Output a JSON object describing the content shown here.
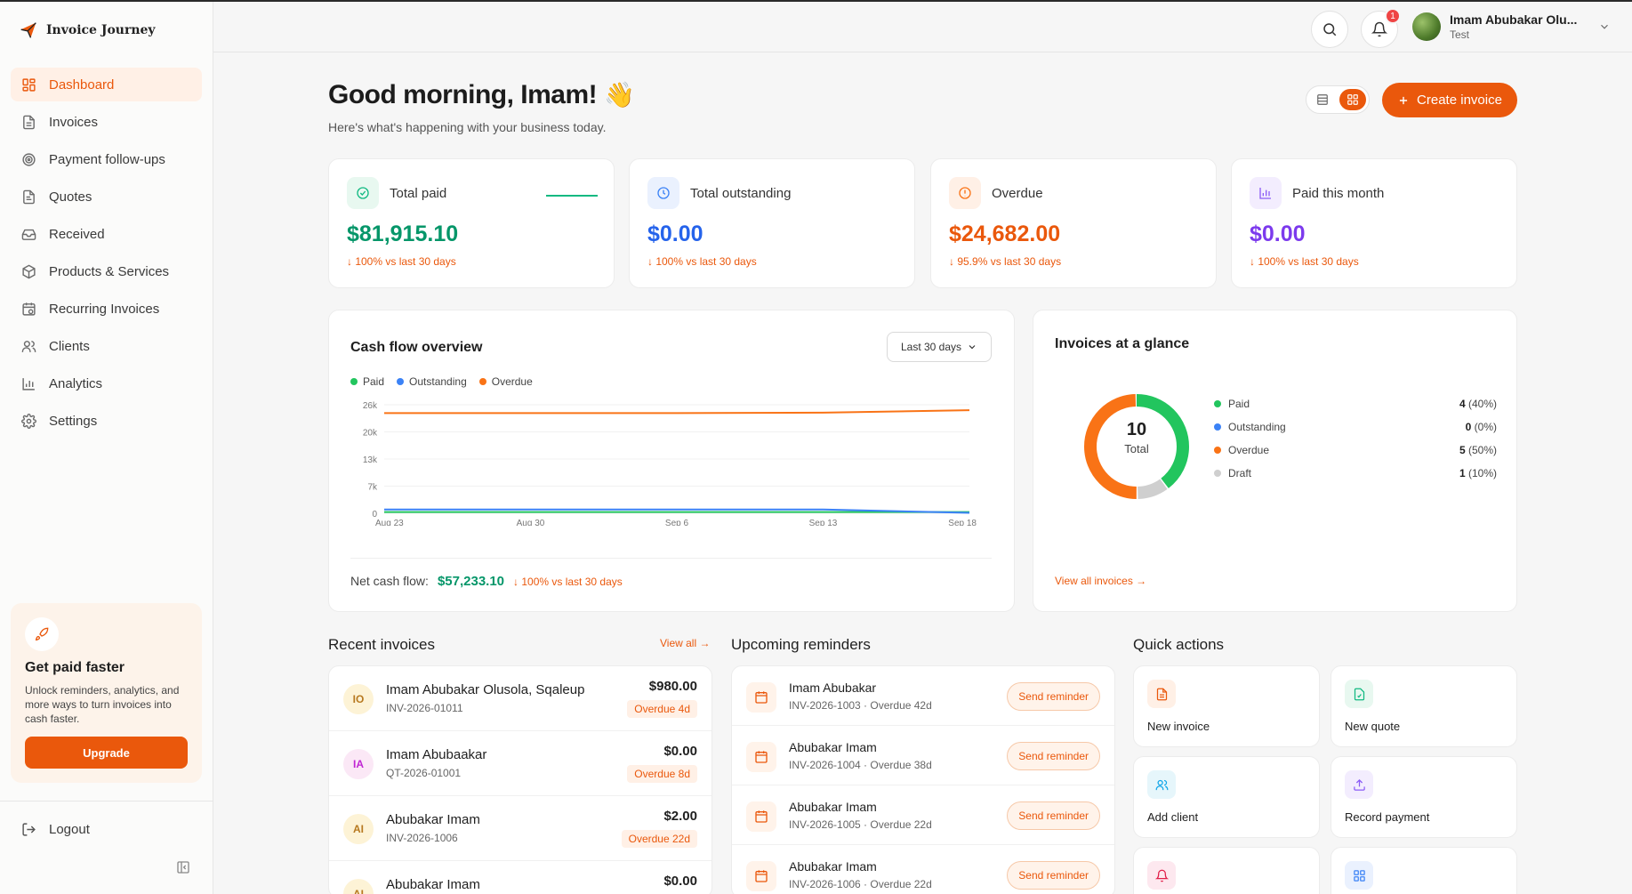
{
  "app": {
    "name": "Invoice Journey"
  },
  "sidebar": {
    "items": [
      {
        "label": "Dashboard",
        "icon": "dashboard-icon",
        "active": true
      },
      {
        "label": "Invoices",
        "icon": "file-icon"
      },
      {
        "label": "Payment follow-ups",
        "icon": "target-icon"
      },
      {
        "label": "Quotes",
        "icon": "quote-icon"
      },
      {
        "label": "Received",
        "icon": "inbox-icon"
      },
      {
        "label": "Products & Services",
        "icon": "package-icon"
      },
      {
        "label": "Recurring Invoices",
        "icon": "calendar-repeat-icon"
      },
      {
        "label": "Clients",
        "icon": "users-icon"
      },
      {
        "label": "Analytics",
        "icon": "bar-chart-icon"
      },
      {
        "label": "Settings",
        "icon": "gear-icon"
      }
    ],
    "promo": {
      "title": "Get paid faster",
      "text": "Unlock reminders, analytics, and more ways to turn invoices into cash faster.",
      "button": "Upgrade"
    },
    "logout": "Logout"
  },
  "topbar": {
    "notifications_count": "1",
    "user_name": "Imam Abubakar Olu...",
    "user_sub": "Test"
  },
  "header": {
    "greeting": "Good morning, Imam!",
    "greeting_emoji": "👋",
    "subtitle": "Here's what's happening with your business today.",
    "create_button": "Create invoice"
  },
  "stats": [
    {
      "label": "Total paid",
      "value": "$81,915.10",
      "delta": "↓ 100% vs last 30 days",
      "color": "#059669",
      "icon_bg": "#e8f8f0",
      "icon_color": "#10b981"
    },
    {
      "label": "Total outstanding",
      "value": "$0.00",
      "delta": "↓ 100% vs last 30 days",
      "color": "#2563eb",
      "icon_bg": "#eaf1fe",
      "icon_color": "#3b82f6"
    },
    {
      "label": "Overdue",
      "value": "$24,682.00",
      "delta": "↓ 95.9% vs last 30 days",
      "color": "#ea580c",
      "icon_bg": "#fff0e6",
      "icon_color": "#f97316"
    },
    {
      "label": "Paid this month",
      "value": "$0.00",
      "delta": "↓ 100% vs last 30 days",
      "color": "#7c3aed",
      "icon_bg": "#f3edfe",
      "icon_color": "#8b5cf6"
    }
  ],
  "cashflow": {
    "title": "Cash flow overview",
    "range": "Last 30 days",
    "legend": [
      "Paid",
      "Outstanding",
      "Overdue"
    ],
    "net_label": "Net cash flow:",
    "net_value": "$57,233.10",
    "net_delta": "↓ 100% vs last 30 days"
  },
  "chart_data": {
    "type": "line",
    "title": "Cash flow overview",
    "x": [
      "Aug 23",
      "Aug 30",
      "Sep 6",
      "Sep 13",
      "Sep 18"
    ],
    "y_ticks": [
      "0",
      "7k",
      "13k",
      "20k",
      "26k"
    ],
    "ylim": [
      0,
      26000
    ],
    "grid": true,
    "legend_placement": "top-left",
    "series": [
      {
        "name": "Paid",
        "color": "#22c55e",
        "values": [
          300,
          300,
          300,
          300,
          300
        ]
      },
      {
        "name": "Outstanding",
        "color": "#3b82f6",
        "values": [
          900,
          900,
          900,
          900,
          100
        ]
      },
      {
        "name": "Overdue",
        "color": "#f97316",
        "values": [
          24000,
          24000,
          24000,
          24100,
          24682
        ]
      }
    ]
  },
  "glance": {
    "title": "Invoices at a glance",
    "total": "10",
    "total_label": "Total",
    "rows": [
      {
        "label": "Paid",
        "count": "4",
        "pct": "(40%)",
        "color": "#22c55e",
        "value": 4
      },
      {
        "label": "Outstanding",
        "count": "0",
        "pct": "(0%)",
        "color": "#3b82f6",
        "value": 0
      },
      {
        "label": "Overdue",
        "count": "5",
        "pct": "(50%)",
        "color": "#f97316",
        "value": 5
      },
      {
        "label": "Draft",
        "count": "1",
        "pct": "(10%)",
        "color": "#cfcfcf",
        "value": 1
      }
    ],
    "view_all": "View all invoices →"
  },
  "recent": {
    "title": "Recent invoices",
    "view_all": "View all →",
    "items": [
      {
        "initials": "IO",
        "name": "Imam Abubakar Olusola, Sqaleup",
        "number": "INV-2026-01011",
        "amount": "$980.00",
        "badge": "Overdue 4d",
        "av_bg": "#fdf3d6",
        "av_color": "#b7791f"
      },
      {
        "initials": "IA",
        "name": "Imam Abubaakar",
        "number": "QT-2026-01001",
        "amount": "$0.00",
        "badge": "Overdue 8d",
        "av_bg": "#fbe8f6",
        "av_color": "#c026d3"
      },
      {
        "initials": "AI",
        "name": "Abubakar Imam",
        "number": "INV-2026-1006",
        "amount": "$2.00",
        "badge": "Overdue 22d",
        "av_bg": "#fdf3d6",
        "av_color": "#b7791f"
      },
      {
        "initials": "AI",
        "name": "Abubakar Imam",
        "number": "",
        "amount": "$0.00",
        "badge": "",
        "av_bg": "#fdf3d6",
        "av_color": "#b7791f"
      }
    ]
  },
  "reminders": {
    "title": "Upcoming reminders",
    "items": [
      {
        "name": "Imam Abubakar",
        "sub": "INV-2026-1003 · Overdue 42d",
        "button": "Send reminder"
      },
      {
        "name": "Abubakar Imam",
        "sub": "INV-2026-1004 · Overdue 38d",
        "button": "Send reminder"
      },
      {
        "name": "Abubakar Imam",
        "sub": "INV-2026-1005 · Overdue 22d",
        "button": "Send reminder"
      },
      {
        "name": "Abubakar Imam",
        "sub": "INV-2026-1006 · Overdue 22d",
        "button": "Send reminder"
      }
    ]
  },
  "quick": {
    "title": "Quick actions",
    "items": [
      {
        "label": "New invoice",
        "icon": "invoice-icon",
        "bg": "#fff0e6",
        "color": "#ea580c"
      },
      {
        "label": "New quote",
        "icon": "quote-icon",
        "bg": "#e8f8f0",
        "color": "#10b981"
      },
      {
        "label": "Add client",
        "icon": "users-icon",
        "bg": "#e6f6fb",
        "color": "#0ea5e9"
      },
      {
        "label": "Record payment",
        "icon": "upload-icon",
        "bg": "#f3edfe",
        "color": "#8b5cf6"
      },
      {
        "label": "",
        "icon": "bell-icon",
        "bg": "#fde8ef",
        "color": "#e11d48"
      },
      {
        "label": "",
        "icon": "grid-icon",
        "bg": "#eaf1fe",
        "color": "#3b82f6"
      }
    ]
  }
}
